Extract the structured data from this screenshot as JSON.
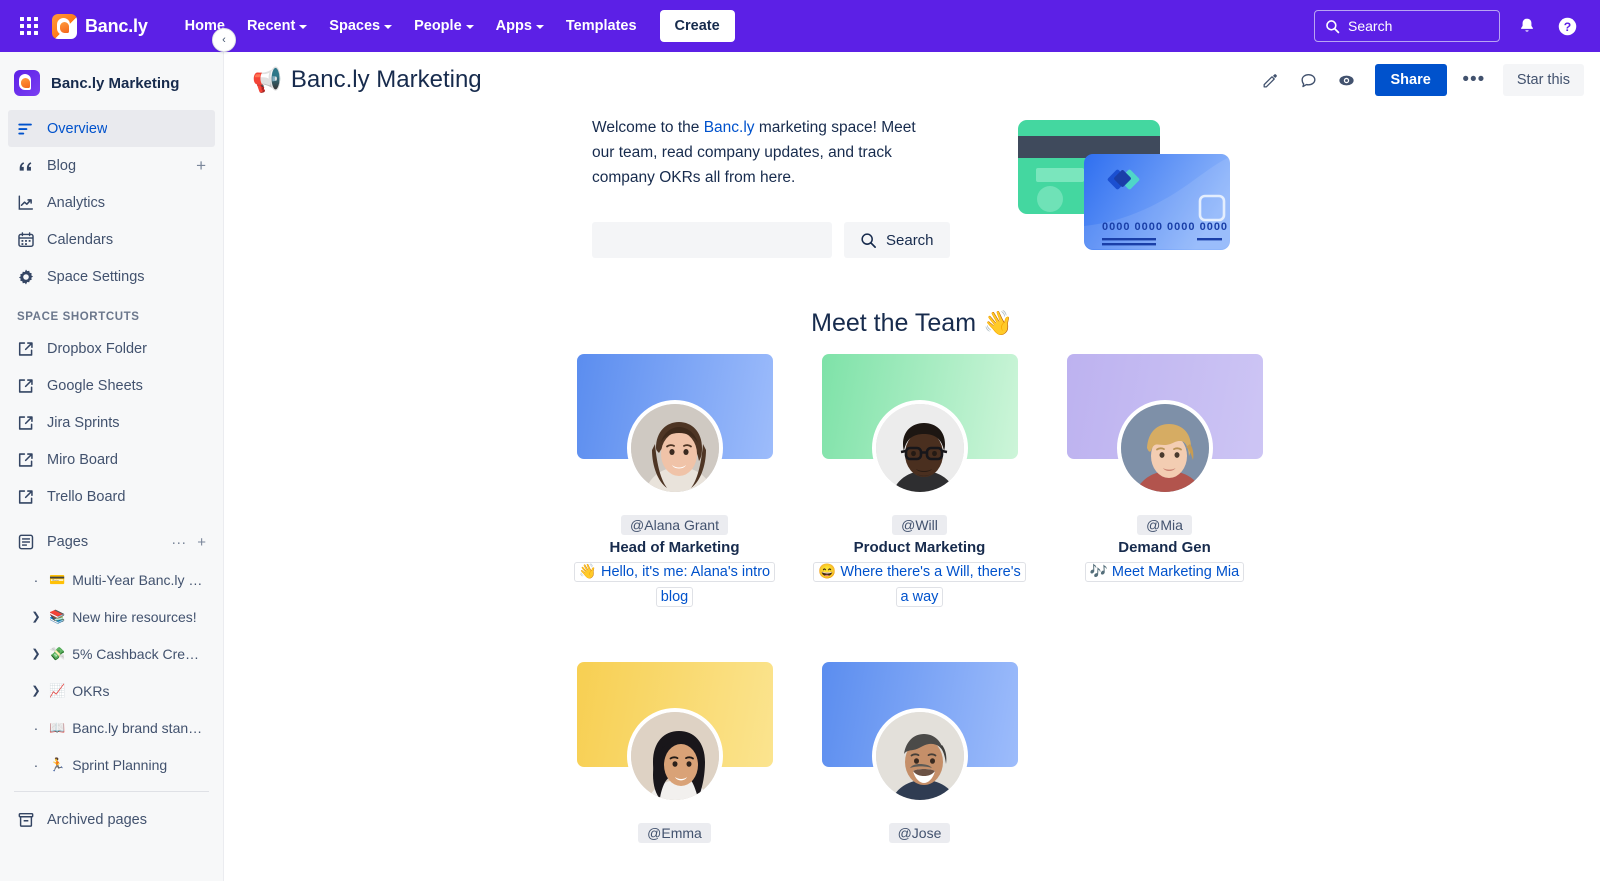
{
  "topnav": {
    "app_switcher_icon": "grid-apps-icon",
    "brand": "Banc.ly",
    "items": [
      {
        "label": "Home",
        "has_caret": false
      },
      {
        "label": "Recent",
        "has_caret": true
      },
      {
        "label": "Spaces",
        "has_caret": true
      },
      {
        "label": "People",
        "has_caret": true
      },
      {
        "label": "Apps",
        "has_caret": true
      },
      {
        "label": "Templates",
        "has_caret": false
      }
    ],
    "create_label": "Create",
    "search_placeholder": "Search",
    "notifications_icon": "bell-icon",
    "help_icon": "help-circle-icon",
    "background_color": "#5c20e6"
  },
  "sidebar": {
    "space_name": "Banc.ly Marketing",
    "collapse_label": "‹",
    "nav": [
      {
        "label": "Overview",
        "icon": "overview-lines-icon",
        "active": true
      },
      {
        "label": "Blog",
        "icon": "quote-icon",
        "active": false,
        "plus": "+"
      },
      {
        "label": "Analytics",
        "icon": "analytics-chart-icon",
        "active": false
      },
      {
        "label": "Calendars",
        "icon": "calendar-icon",
        "active": false
      },
      {
        "label": "Space Settings",
        "icon": "gear-icon",
        "active": false
      }
    ],
    "shortcuts_label": "SPACE SHORTCUTS",
    "shortcuts": [
      {
        "label": "Dropbox Folder",
        "icon": "external-link-icon"
      },
      {
        "label": "Google Sheets",
        "icon": "external-link-icon"
      },
      {
        "label": "Jira Sprints",
        "icon": "external-link-icon"
      },
      {
        "label": "Miro Board",
        "icon": "external-link-icon"
      },
      {
        "label": "Trello Board",
        "icon": "external-link-icon"
      }
    ],
    "pages_label": "Pages",
    "pages_more": "···",
    "pages_add": "+",
    "pages": [
      {
        "label": "Multi-Year Banc.ly …",
        "emoji": "💳",
        "expandable": false
      },
      {
        "label": "New hire resources!",
        "emoji": "📚",
        "expandable": true
      },
      {
        "label": "5% Cashback Cre…",
        "emoji": "💸",
        "expandable": true
      },
      {
        "label": "OKRs",
        "emoji": "📈",
        "expandable": true
      },
      {
        "label": "Banc.ly brand stan…",
        "emoji": "📖",
        "expandable": false
      },
      {
        "label": "Sprint Planning",
        "emoji": "🏃",
        "expandable": false
      }
    ],
    "archived_label": "Archived pages",
    "archived_icon": "archive-box-icon"
  },
  "page_header": {
    "emoji": "📢",
    "title": "Banc.ly Marketing",
    "edit_icon": "pencil-icon",
    "comment_icon": "comment-icon",
    "watch_icon": "eye-icon",
    "share_label": "Share",
    "more_label": "•••",
    "star_label": "Star this"
  },
  "content": {
    "welcome": {
      "before": "Welcome to the ",
      "link": "Banc.ly",
      "after": " marketing space! Meet our team, read company updates, and track company OKRs all from here."
    },
    "search": {
      "value": "",
      "placeholder": "",
      "button_label": "Search",
      "button_icon": "search-icon"
    },
    "illustration": "credit-cards-illustration",
    "team_heading": "Meet the Team",
    "team_heading_emoji": "👋",
    "team": [
      {
        "handle": "@Alana Grant",
        "role": "Head of Marketing",
        "link_emoji": "👋",
        "link_text": "Hello, it's me: Alana's intro blog",
        "banner_color": "blue"
      },
      {
        "handle": "@Will",
        "role": "Product Marketing",
        "link_emoji": "😄",
        "link_text": "Where there's a Will, there's a way",
        "banner_color": "green"
      },
      {
        "handle": "@Mia",
        "role": "Demand Gen",
        "link_emoji": "🎶",
        "link_text": "Meet Marketing Mia",
        "banner_color": "purple"
      },
      {
        "handle": "@Emma",
        "role": "",
        "link_emoji": "",
        "link_text": "",
        "banner_color": "yellow"
      },
      {
        "handle": "@Jose",
        "role": "",
        "link_emoji": "",
        "link_text": "",
        "banner_color": "blue2"
      }
    ]
  },
  "colors": {
    "nav_purple": "#5c20e6",
    "link_blue": "#0052cc",
    "text": "#172b4d",
    "sidebar_bg": "#f7f8f9"
  }
}
